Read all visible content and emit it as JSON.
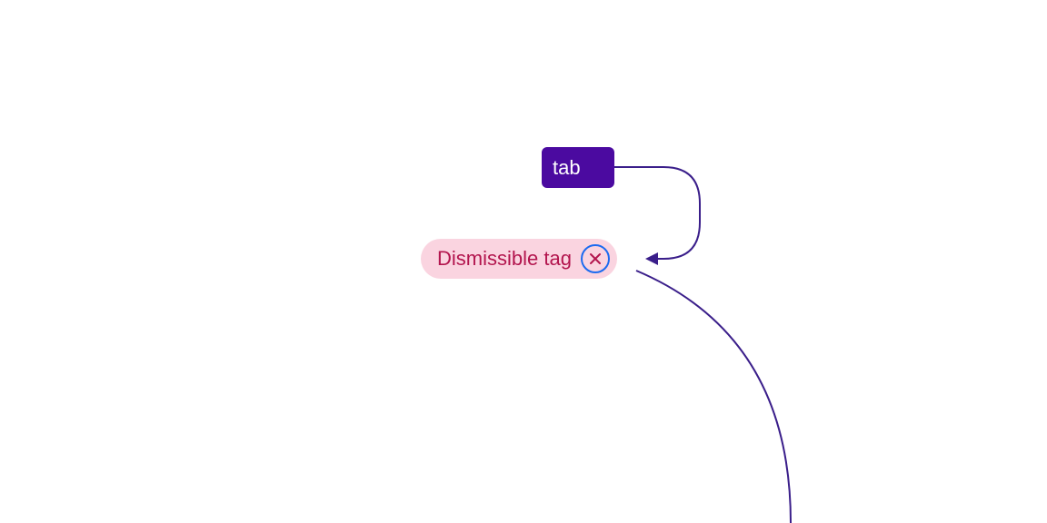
{
  "colors": {
    "purple": "#4B0AA0",
    "pink_bg": "#FAD4E0",
    "pink_text": "#B3154E",
    "focus_ring": "#1C6BF0",
    "connector": "#3A1E8A",
    "white": "#FFFFFF"
  },
  "tab": {
    "label": "tab"
  },
  "tag": {
    "label": "Dismissible tag"
  }
}
